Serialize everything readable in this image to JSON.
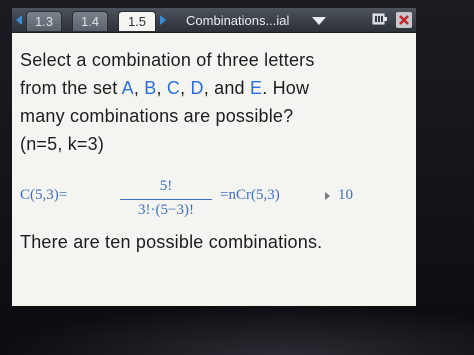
{
  "window": {
    "tabs": [
      {
        "label": "1.3"
      },
      {
        "label": "1.4"
      },
      {
        "label": "1.5"
      }
    ],
    "doc_title": "Combinations...ial"
  },
  "icons": {
    "prev_page": "left-arrow-icon",
    "next_page": "right-arrow-icon",
    "dropdown": "chevron-down-icon",
    "battery": "battery-icon",
    "close": "close-icon"
  },
  "colors": {
    "accent_blue": "#2b70d6",
    "math_blue": "#3f6fc4",
    "titlebar": "#3a3f47",
    "screen_bg": "#f4f4f0"
  },
  "problem": {
    "line1": "Select a combination of three letters",
    "line2_prefix": "from the set ",
    "letter_a": "A",
    "sep1": ", ",
    "letter_b": "B",
    "sep2": ", ",
    "letter_c": "C",
    "sep3": ", ",
    "letter_d": "D",
    "sep4": ", and ",
    "letter_e": "E",
    "line2_suffix": ".  How",
    "line3": "many combinations are possible?",
    "line4": "(n=5, k=3)"
  },
  "math": {
    "lhs": "C(5,3)=",
    "numerator": "5!",
    "denominator": "3!·(5−3)!",
    "rhs": "=nCr(5,3)",
    "result": "10"
  },
  "conclusion": "There are ten possible combinations."
}
